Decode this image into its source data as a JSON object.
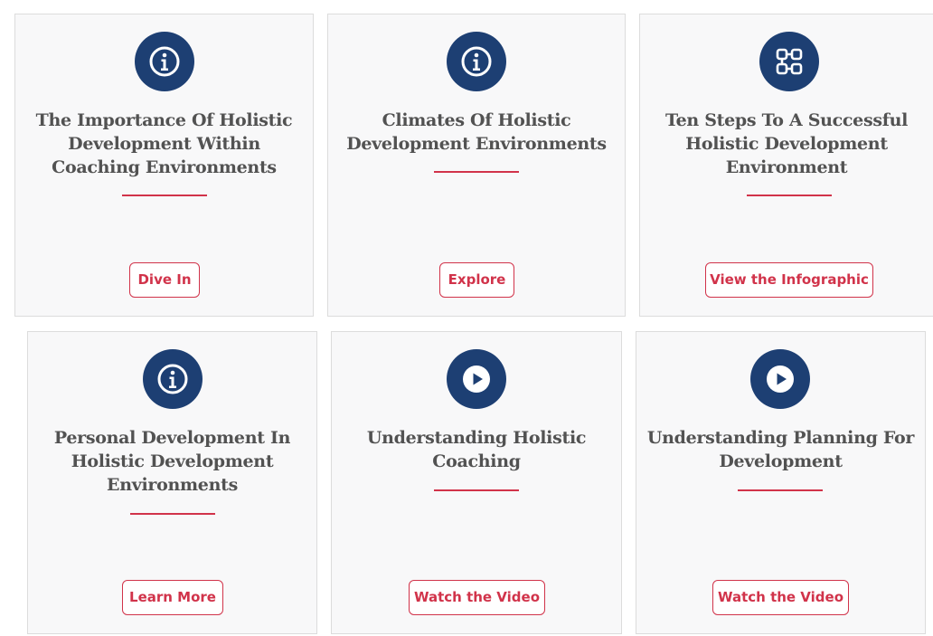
{
  "colors": {
    "accent": "#d1334a",
    "icon_bg": "#1d3f73",
    "title": "#525252",
    "card_bg": "#f8f8f9"
  },
  "cards": [
    {
      "icon": "info-icon",
      "title": "The Importance Of Holistic Development Within Coaching Environments",
      "button": "Dive In"
    },
    {
      "icon": "info-icon",
      "title": "Climates Of Holistic Development Environments",
      "button": "Explore"
    },
    {
      "icon": "infographic-icon",
      "title": "Ten Steps To A Successful Holistic Development Environment",
      "button": "View the Infographic"
    },
    {
      "icon": "info-icon",
      "title": "Personal Development In Holistic Development Environments",
      "button": "Learn More"
    },
    {
      "icon": "play-icon",
      "title": "Understanding Holistic Coaching",
      "button": "Watch the Video"
    },
    {
      "icon": "play-icon",
      "title": "Understanding Planning For Development",
      "button": "Watch the Video"
    }
  ]
}
